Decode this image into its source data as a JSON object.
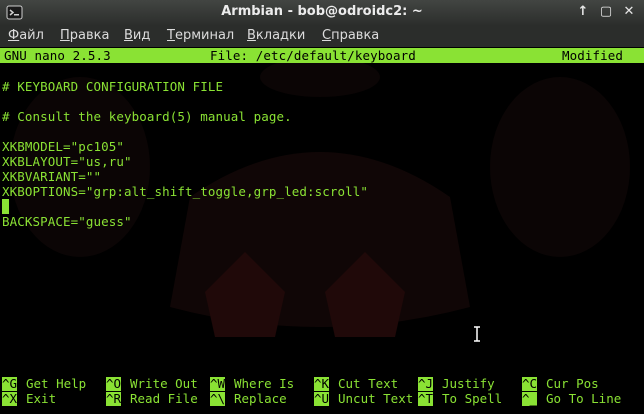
{
  "window": {
    "title": "Armbian - bob@odroidc2: ~",
    "buttons": {
      "minimize": "↑",
      "maximize": "▢",
      "close": "✕"
    },
    "accent": "#8ae234"
  },
  "menubar": {
    "items": [
      {
        "label": "Файл",
        "access": "Ф",
        "rest": "айл"
      },
      {
        "label": "Правка",
        "access": "П",
        "rest": "равка"
      },
      {
        "label": "Вид",
        "access": "В",
        "rest": "ид"
      },
      {
        "label": "Терминал",
        "access": "Т",
        "rest": "ерминал"
      },
      {
        "label": "Вкладки",
        "access": "В",
        "rest": "кладки"
      },
      {
        "label": "Справка",
        "access": "С",
        "rest": "правка"
      }
    ]
  },
  "nano": {
    "version": "GNU nano 2.5.3",
    "file": "File: /etc/default/keyboard",
    "status": "Modified",
    "lines": [
      "# KEYBOARD CONFIGURATION FILE",
      "",
      "# Consult the keyboard(5) manual page.",
      "",
      "XKBMODEL=\"pc105\"",
      "XKBLAYOUT=\"us,ru\"",
      "XKBVARIANT=\"\"",
      "XKBOPTIONS=\"grp:alt_shift_toggle,grp_led:scroll\"",
      "",
      "BACKSPACE=\"guess\""
    ],
    "shortcuts_row1": [
      {
        "key": "^G",
        "label": "Get Help"
      },
      {
        "key": "^O",
        "label": "Write Out"
      },
      {
        "key": "^W",
        "label": "Where Is"
      },
      {
        "key": "^K",
        "label": "Cut Text"
      },
      {
        "key": "^J",
        "label": "Justify"
      },
      {
        "key": "^C",
        "label": "Cur Pos"
      }
    ],
    "shortcuts_row2": [
      {
        "key": "^X",
        "label": "Exit"
      },
      {
        "key": "^R",
        "label": "Read File"
      },
      {
        "key": "^\\",
        "label": "Replace"
      },
      {
        "key": "^U",
        "label": "Uncut Text"
      },
      {
        "key": "^T",
        "label": "To Spell"
      },
      {
        "key": "^_",
        "label": "Go To Line"
      }
    ]
  }
}
